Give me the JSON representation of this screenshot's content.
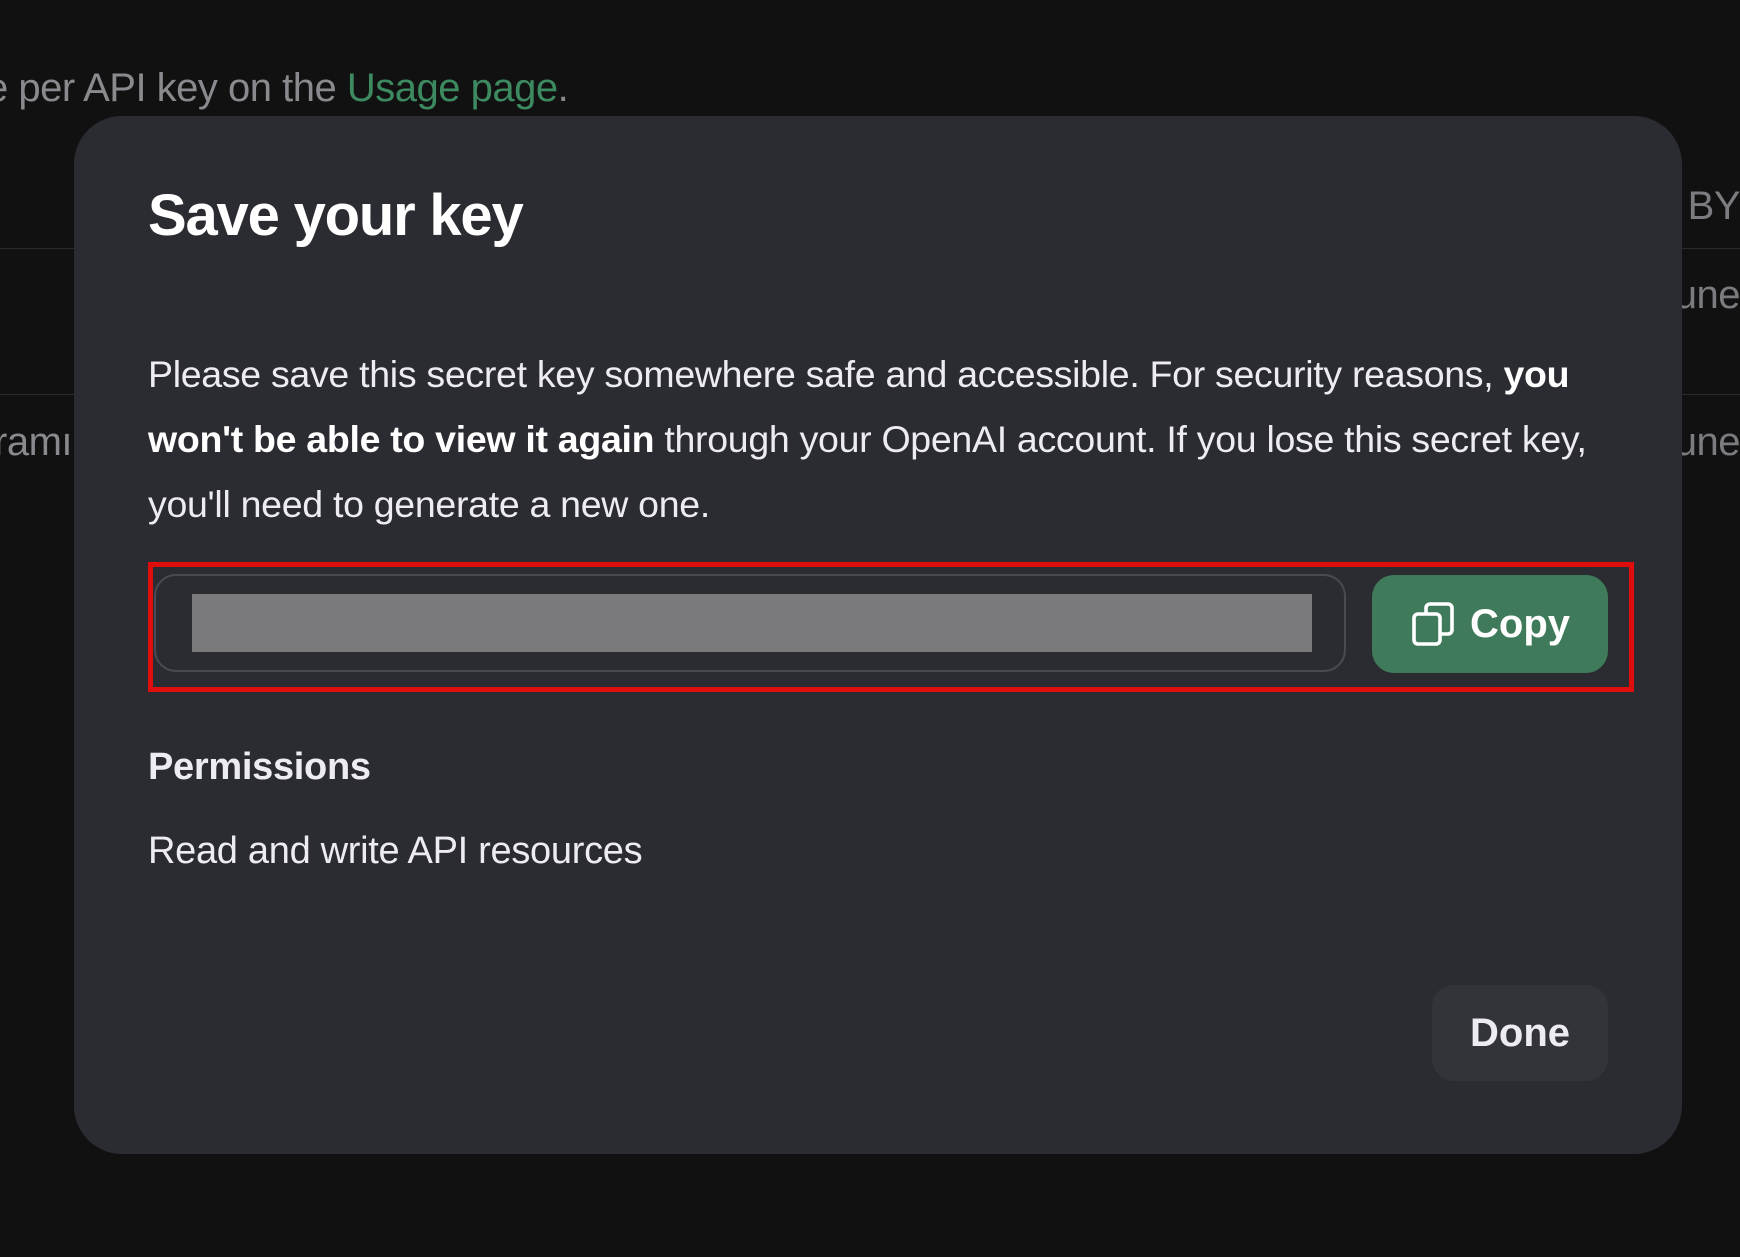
{
  "background": {
    "usage_line_prefix": "e per API key on the ",
    "usage_link": "Usage page",
    "usage_line_suffix": ".",
    "left_fragment": "ramı",
    "right_fragment_1": "D BY",
    "right_fragment_2": "une",
    "right_fragment_3": "une"
  },
  "modal": {
    "title": "Save your key",
    "description_part1": "Please save this secret key somewhere safe and accessible. For security reasons, ",
    "description_bold": "you won't be able to view it again",
    "description_part2": " through your OpenAI account. If you lose this secret key, you'll need to generate a new one.",
    "key_field": {
      "value_redacted": true
    },
    "copy_button": {
      "label": "Copy",
      "icon": "copy-icon"
    },
    "permissions": {
      "heading": "Permissions",
      "value": "Read and write API resources"
    },
    "done_button": {
      "label": "Done"
    }
  },
  "colors": {
    "page_background": "#111112",
    "modal_background": "#2b2c31",
    "copy_button": "#3f7a5b",
    "link_green": "#3d8a60",
    "highlight_red": "#e00d0d",
    "redaction_gray": "#7a7a7c"
  }
}
